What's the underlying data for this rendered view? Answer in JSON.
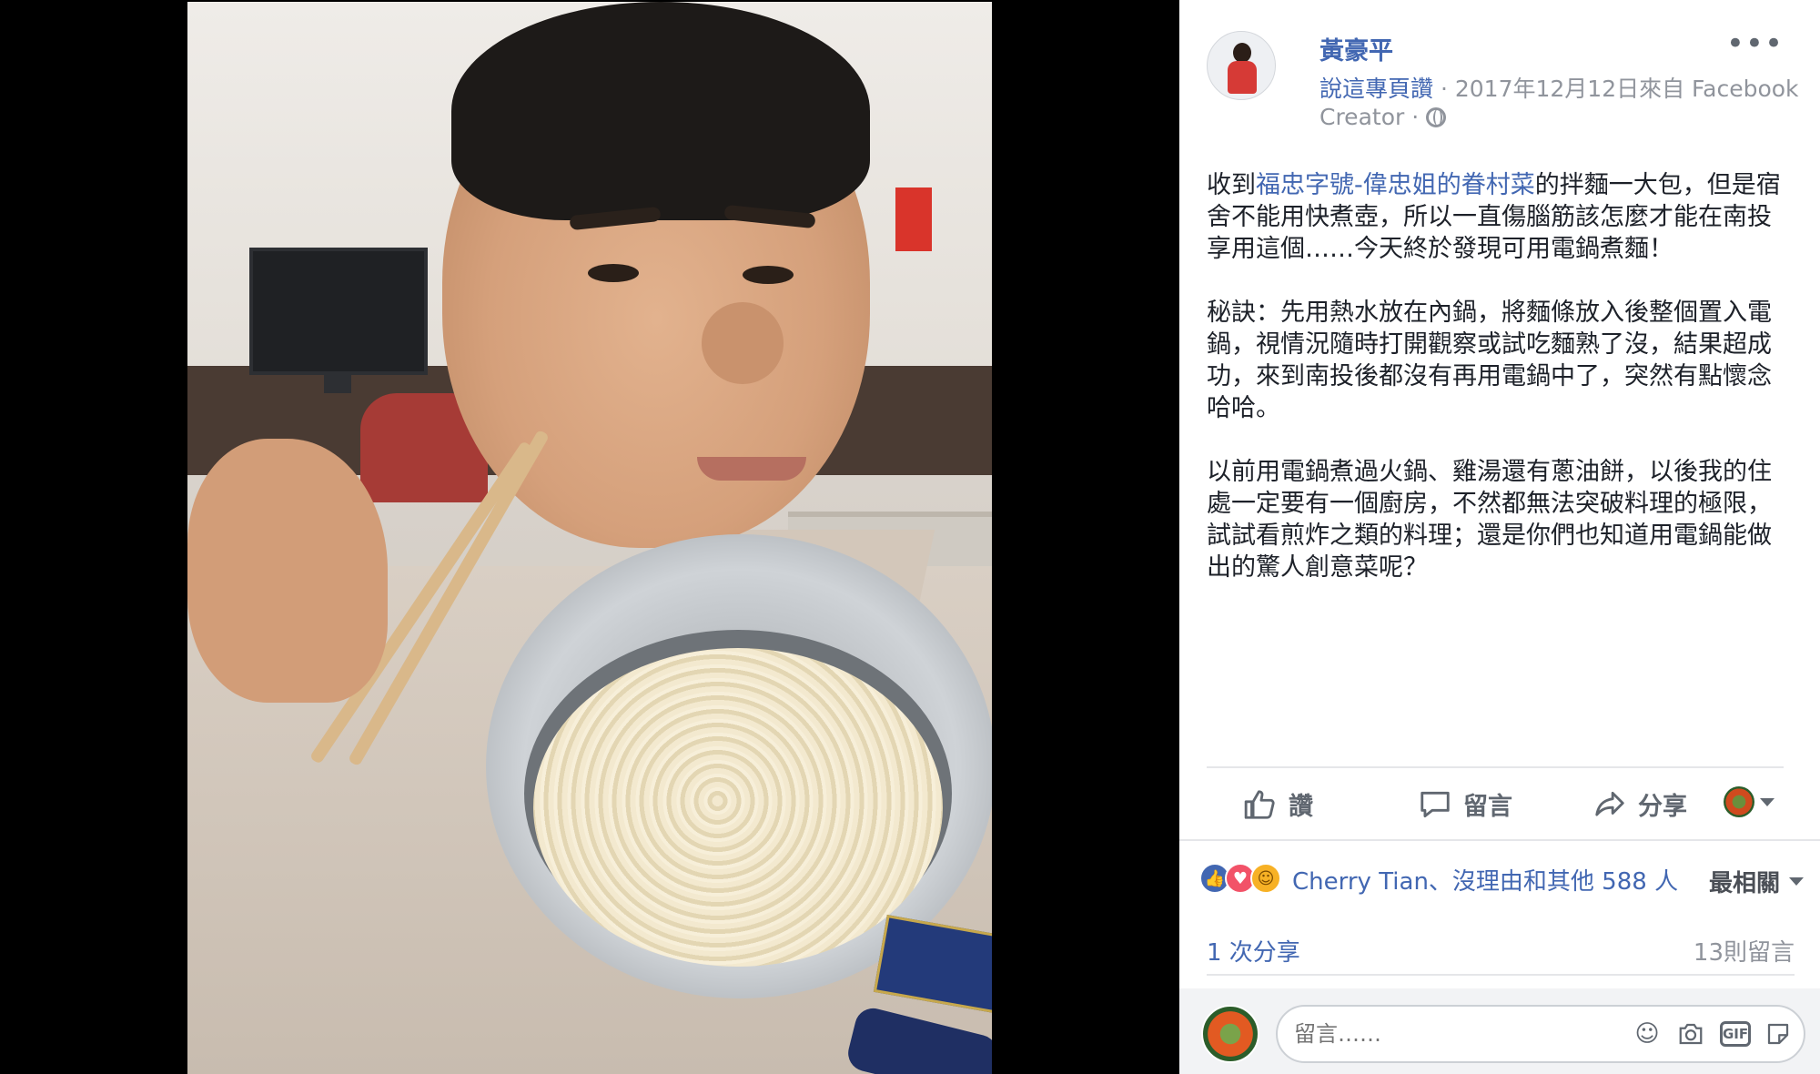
{
  "post": {
    "author": "黃豪平",
    "meta_link": "說這專頁讚",
    "meta_sep1": " · ",
    "meta_date": "2017年12月12日來自 Facebook",
    "meta_creator": "Creator · ",
    "privacy_icon": "globe-icon",
    "more_label": "•••",
    "paragraph1_prefix": "收到",
    "paragraph1_tag": "福忠字號-偉忠姐的眷村菜",
    "paragraph1_suffix": "的拌麵一大包，但是宿舍不能用快煮壺，所以一直傷腦筋該怎麼才能在南投享用這個……今天終於發現可用電鍋煮麵！",
    "paragraph2": "秘訣：先用熱水放在內鍋，將麵條放入後整個置入電鍋，視情況隨時打開觀察或試吃麵熟了沒，結果超成功，來到南投後都沒有再用電鍋中了，突然有點懷念哈哈。",
    "paragraph3": "以前用電鍋煮過火鍋、雞湯還有蔥油餅，以後我的住處一定要有一個廚房，不然都無法突破料理的極限，試試看煎炸之類的料理；還是你們也知道用電鍋能做出的驚人創意菜呢？"
  },
  "actions": {
    "like": "讚",
    "comment": "留言",
    "share": "分享"
  },
  "reactions": {
    "names": "Cherry Tian、沒理由和其他 588 人",
    "sort": "最相關"
  },
  "stats": {
    "shares": "1 次分享",
    "comments": "13則留言"
  },
  "comment_box": {
    "placeholder": "留言……"
  },
  "colors": {
    "link": "#4267b2",
    "muted": "#90949c",
    "like": "#4267b2",
    "love": "#f25268",
    "haha": "#f7b125"
  }
}
